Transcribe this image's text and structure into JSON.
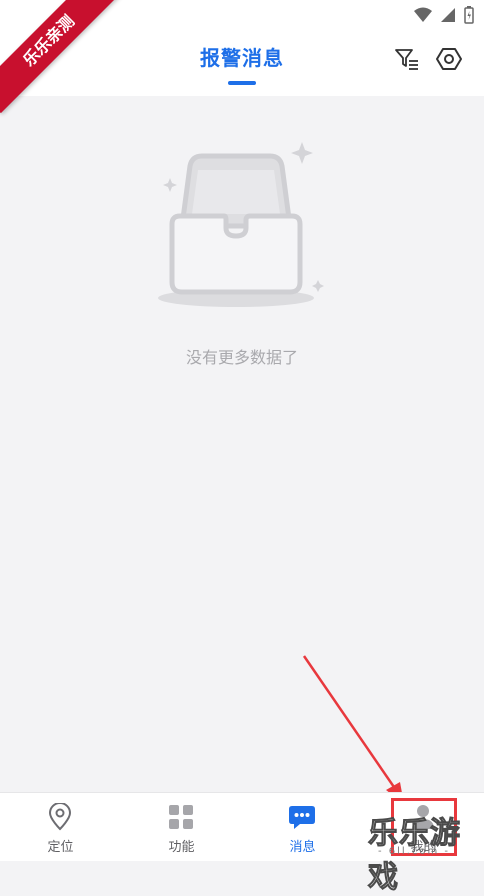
{
  "header": {
    "title": "报警消息"
  },
  "empty_state": {
    "message": "没有更多数据了"
  },
  "tabs": [
    {
      "label": "定位",
      "icon": "location-pin-icon",
      "active": false
    },
    {
      "label": "功能",
      "icon": "grid-icon",
      "active": false
    },
    {
      "label": "消息",
      "icon": "chat-bubble-icon",
      "active": true
    },
    {
      "label": "我的",
      "icon": "person-icon",
      "active": false
    }
  ],
  "overlay": {
    "ribbon_text": "乐乐亲测",
    "watermark_text": "乐乐游戏",
    "watermark_sub": "- 6ll.com -"
  },
  "colors": {
    "accent": "#1e6fe8",
    "highlight": "#e8383d",
    "ribbon": "#c8102e"
  }
}
